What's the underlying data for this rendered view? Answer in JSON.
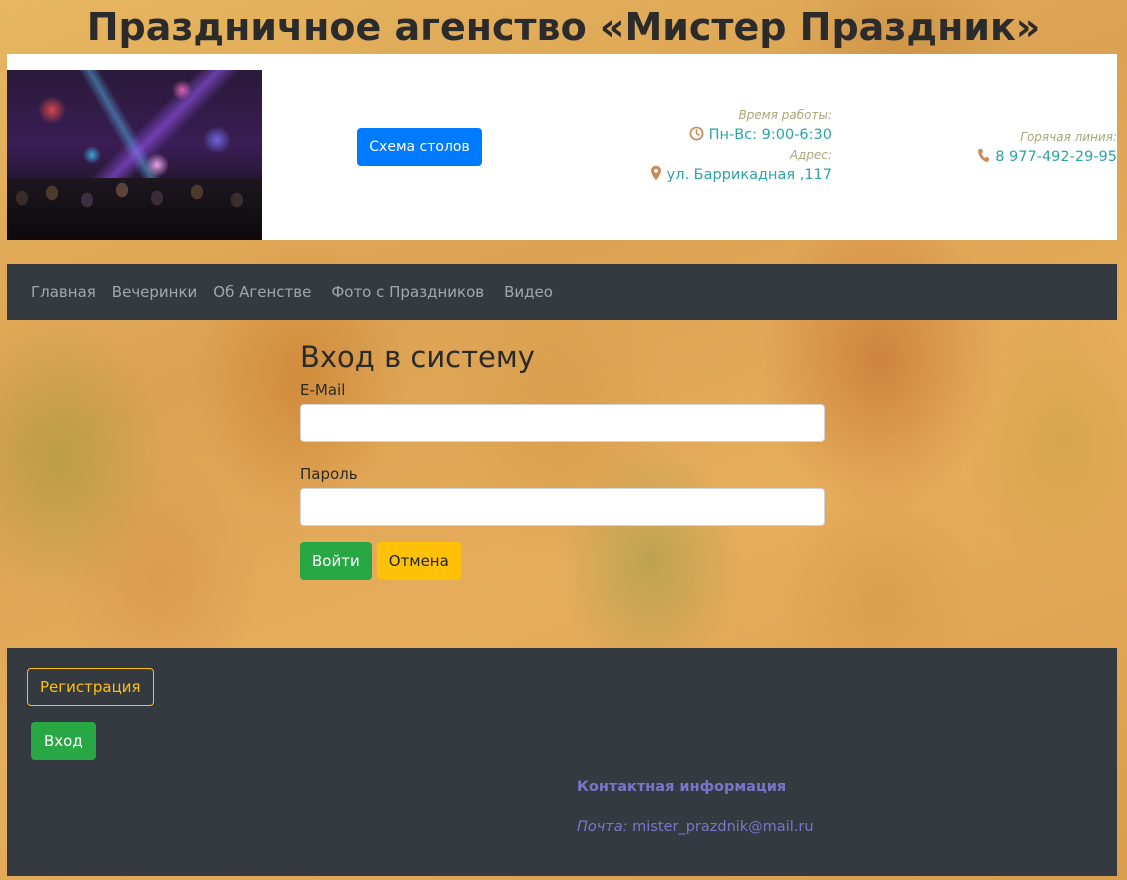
{
  "site": {
    "title": "Праздничное агенство «Мистер Праздник»"
  },
  "header": {
    "scheme_button": "Схема столов",
    "hours_label": "Время работы:",
    "hours_value": "Пн-Вс: 9:00-6:30",
    "address_label": "Адрес:",
    "address_value": "ул. Баррикадная ,117",
    "hotline_label": "Горячая линия:",
    "hotline_value": "8 977-492-29-95",
    "icons": {
      "clock": "clock-icon",
      "pin": "map-pin-icon",
      "phone": "phone-icon"
    }
  },
  "nav": {
    "items": [
      {
        "label": "Главная"
      },
      {
        "label": "Вечеринки"
      },
      {
        "label": "Об Агенстве"
      },
      {
        "label": "Фото с Праздников"
      },
      {
        "label": "Видео"
      }
    ]
  },
  "login": {
    "heading": "Вход в систему",
    "email_label": "E-Mail",
    "email_value": "",
    "password_label": "Пароль",
    "password_value": "",
    "submit_label": "Войти",
    "cancel_label": "Отмена"
  },
  "footer": {
    "register_label": "Регистрация",
    "enter_label": "Вход",
    "contacts_title": "Контактная информация",
    "mail_label": "Почта:",
    "mail_value": "mister_prazdnik@mail.ru"
  },
  "colors": {
    "primary": "#007bff",
    "success": "#28a745",
    "warning": "#ffc107",
    "dark": "#343a40",
    "info_teal": "#2ba3a7",
    "contact_purple": "#7b75c9",
    "icon_orange": "#c98a5a"
  }
}
